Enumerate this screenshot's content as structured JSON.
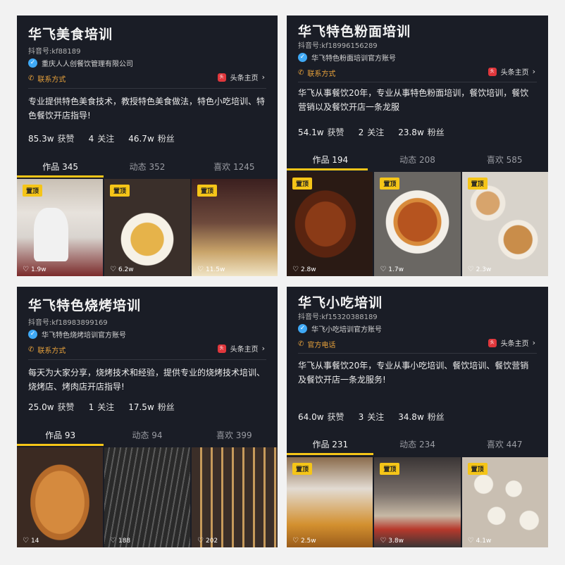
{
  "colors": {
    "accent": "#f5c518",
    "verified": "#3fa9f5",
    "contact": "#e8a23b",
    "toutiao": "#e0373c",
    "panel_bg": "#1a1d26"
  },
  "icons": {
    "verified": "checkmark-icon",
    "contact": "phone-icon",
    "toutiao": "toutiao-icon",
    "likes": "heart-icon",
    "chevron": "chevron-right-icon"
  },
  "panels": [
    {
      "title": "华飞美食培训",
      "douyin_id": "抖音号:kf88189",
      "verified_label": "重庆人人创餐饮管理有限公司",
      "contact_label": "联系方式",
      "toutiao_label": "头条主页",
      "bio": "专业提供特色美食技术，教授特色美食做法，特色小吃培训、特色餐饮开店指导!",
      "stats": [
        {
          "num": "85.3w",
          "label": "获赞"
        },
        {
          "num": "4",
          "label": "关注"
        },
        {
          "num": "46.7w",
          "label": "粉丝"
        }
      ],
      "tabs": [
        "作品 345",
        "动态 352",
        "喜欢 1245"
      ],
      "thumbs": [
        {
          "badge": "置顶",
          "likes": "1.9w"
        },
        {
          "badge": "置顶",
          "likes": "6.2w"
        },
        {
          "badge": "置顶",
          "likes": "11.5w"
        }
      ]
    },
    {
      "title": "华飞特色粉面培训",
      "douyin_id": "抖音号:kf18996156289",
      "verified_label": "华飞特色粉面培训官方账号",
      "contact_label": "联系方式",
      "toutiao_label": "头条主页",
      "bio": "华飞从事餐饮20年，专业从事特色粉面培训，餐饮培训，餐饮营销以及餐饮开店一条龙服",
      "stats": [
        {
          "num": "54.1w",
          "label": "获赞"
        },
        {
          "num": "2",
          "label": "关注"
        },
        {
          "num": "23.8w",
          "label": "粉丝"
        }
      ],
      "tabs": [
        "作品 194",
        "动态 208",
        "喜欢 585"
      ],
      "thumbs": [
        {
          "badge": "置顶",
          "likes": "2.8w"
        },
        {
          "badge": "置顶",
          "likes": "1.7w"
        },
        {
          "badge": "置顶",
          "likes": "2.3w"
        }
      ]
    },
    {
      "title": "华飞特色烧烤培训",
      "douyin_id": "抖音号:kf18983899169",
      "verified_label": "华飞特色烧烤培训官方账号",
      "contact_label": "联系方式",
      "toutiao_label": "头条主页",
      "bio": "每天为大家分享，烧烤技术和经验，提供专业的烧烤技术培训、烧烤店、烤肉店开店指导!",
      "stats": [
        {
          "num": "25.0w",
          "label": "获赞"
        },
        {
          "num": "1",
          "label": "关注"
        },
        {
          "num": "17.5w",
          "label": "粉丝"
        }
      ],
      "tabs": [
        "作品 93",
        "动态 94",
        "喜欢 399"
      ],
      "thumbs": [
        {
          "badge": "",
          "likes": "14"
        },
        {
          "badge": "",
          "likes": "188"
        },
        {
          "badge": "",
          "likes": "202"
        }
      ]
    },
    {
      "title": "华飞小吃培训",
      "douyin_id": "抖音号:kf15320388189",
      "verified_label": "华飞小吃培训官方账号",
      "contact_label": "官方电话",
      "toutiao_label": "头条主页",
      "bio": "华飞从事餐饮20年，专业从事小吃培训、餐饮培训、餐饮营销及餐饮开店一条龙服务!",
      "stats": [
        {
          "num": "64.0w",
          "label": "获赞"
        },
        {
          "num": "3",
          "label": "关注"
        },
        {
          "num": "34.8w",
          "label": "粉丝"
        }
      ],
      "tabs": [
        "作品 231",
        "动态 234",
        "喜欢 447"
      ],
      "thumbs": [
        {
          "badge": "置顶",
          "likes": "2.5w"
        },
        {
          "badge": "置顶",
          "likes": "3.8w"
        },
        {
          "badge": "置顶",
          "likes": "4.1w"
        }
      ]
    }
  ]
}
